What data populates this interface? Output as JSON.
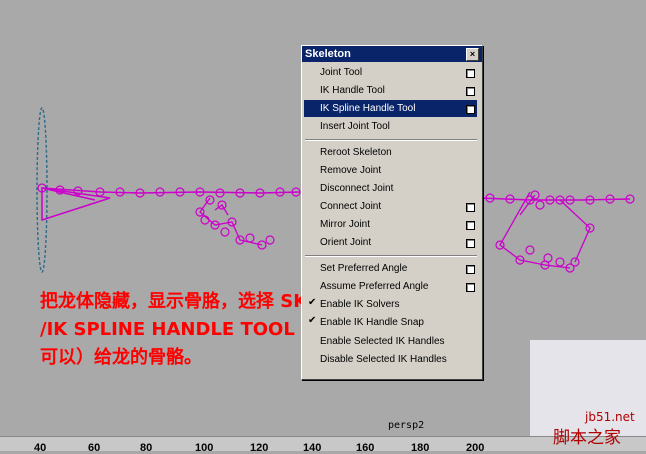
{
  "menu": {
    "title": "Skeleton",
    "close_glyph": "×",
    "items": [
      {
        "label": "Joint Tool",
        "option": true,
        "selected": false
      },
      {
        "label": "IK Handle Tool",
        "option": true,
        "selected": false
      },
      {
        "label": "IK Spline Handle Tool",
        "option": true,
        "selected": true
      },
      {
        "label": "Insert Joint Tool",
        "option": false,
        "selected": false
      },
      {
        "label": "Reroot Skeleton",
        "option": false,
        "selected": false
      },
      {
        "label": "Remove Joint",
        "option": false,
        "selected": false
      },
      {
        "label": "Disconnect Joint",
        "option": false,
        "selected": false
      },
      {
        "label": "Connect Joint",
        "option": true,
        "selected": false
      },
      {
        "label": "Mirror Joint",
        "option": true,
        "selected": false
      },
      {
        "label": "Orient Joint",
        "option": true,
        "selected": false
      },
      {
        "label": "Set Preferred Angle",
        "option": true,
        "selected": false
      },
      {
        "label": "Assume Preferred Angle",
        "option": true,
        "selected": false
      },
      {
        "label": "Enable IK Solvers",
        "option": false,
        "selected": false,
        "checked": true
      },
      {
        "label": "Enable IK Handle Snap",
        "option": false,
        "selected": false,
        "checked": true
      },
      {
        "label": "Enable Selected IK Handles",
        "option": false,
        "selected": false
      },
      {
        "label": "Disable Selected IK Handles",
        "option": false,
        "selected": false
      }
    ]
  },
  "annotation": {
    "line1": "把龙体隐藏，显示骨胳，选择 SKELETON",
    "line2": "/IK SPLINE HANDLE TOOL  (默认参数就",
    "line3": "可以）给龙的骨骼。"
  },
  "viewport": {
    "camera_label": "persp2"
  },
  "timeline": {
    "ticks": [
      "40",
      "60",
      "80",
      "100",
      "120",
      "140",
      "160",
      "180",
      "200"
    ]
  },
  "watermark": {
    "site": "jb51.net",
    "name": "脚本之家"
  },
  "colors": {
    "joint": "#cc00cc",
    "selected_bg": "#0a246a",
    "annotation": "#ff0000"
  }
}
